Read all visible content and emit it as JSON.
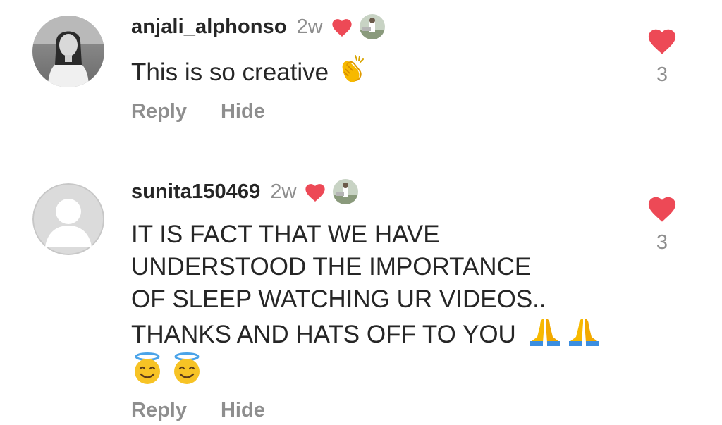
{
  "colors": {
    "heart": "#ed4956",
    "secondary_text": "#8e8e8e",
    "primary_text": "#262626"
  },
  "comments": [
    {
      "username": "anjali_alphonso",
      "time": "2w",
      "text_lines": [
        "This is so creative"
      ],
      "emoji_line": "",
      "trailing_emoji": "clapping-hands",
      "liked_by_creator": true,
      "like_count": "3",
      "reply_label": "Reply",
      "hide_label": "Hide",
      "avatar": "profile-photo"
    },
    {
      "username": "sunita150469",
      "time": "2w",
      "text_lines": [
        "IT IS FACT THAT WE HAVE",
        "UNDERSTOOD THE IMPORTANCE",
        "OF SLEEP WATCHING UR VIDEOS..",
        "THANKS AND HATS OFF TO YOU"
      ],
      "trailing_emoji": "folded-hands x2",
      "emoji_line": "smiling-face-with-halo x2",
      "liked_by_creator": true,
      "like_count": "3",
      "reply_label": "Reply",
      "hide_label": "Hide",
      "avatar": "default-avatar"
    }
  ]
}
